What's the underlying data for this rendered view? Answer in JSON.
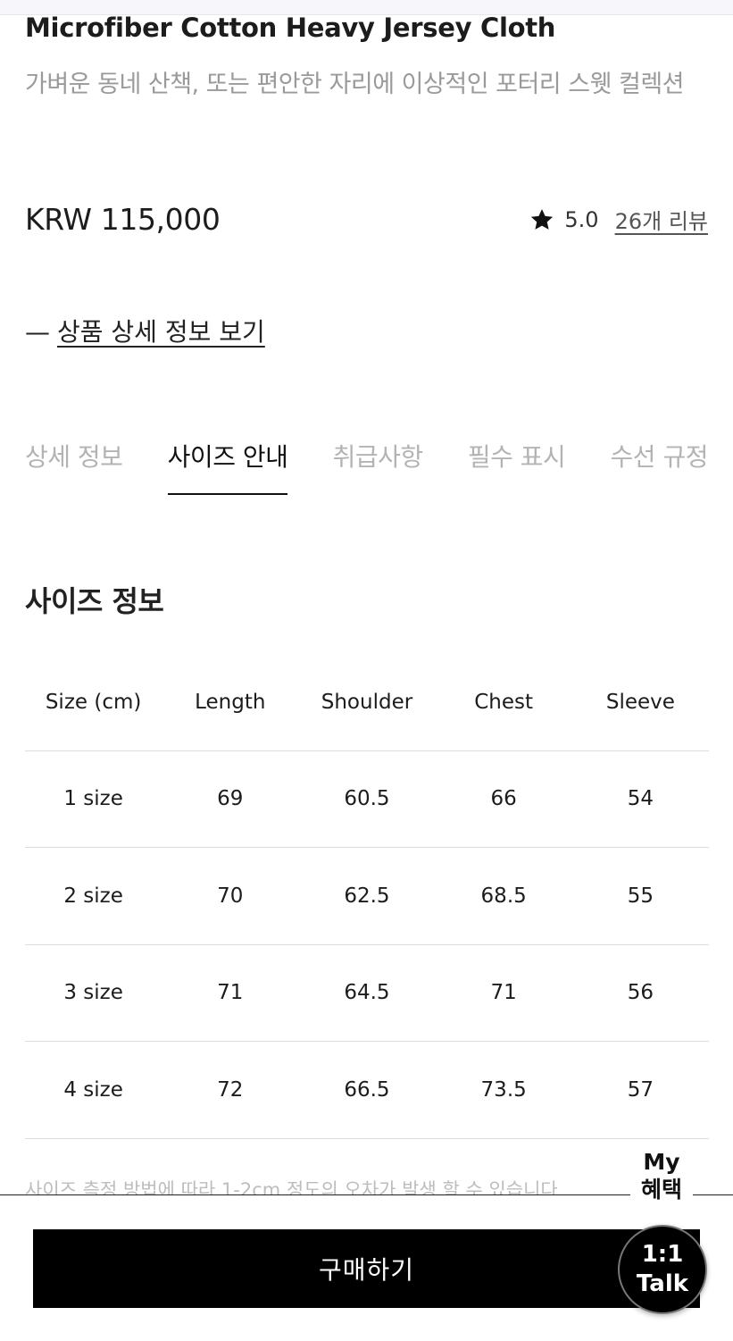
{
  "product": {
    "name": "Microfiber Cotton Heavy Jersey Cloth",
    "description": "가벼운 동네 산책, 또는 편안한 자리에 이상적인 포터리 스웻 컬렉션",
    "price": "KRW 115,000",
    "rating": "5.0",
    "review_count": "26개 리뷰",
    "detail_toggle_dash": "—",
    "detail_toggle_label": "상품 상세 정보 보기"
  },
  "tabs": [
    {
      "label": "상세 정보",
      "active": false
    },
    {
      "label": "사이즈 안내",
      "active": true
    },
    {
      "label": "취급사항",
      "active": false
    },
    {
      "label": "필수 표시",
      "active": false
    },
    {
      "label": "수선 규정",
      "active": false
    }
  ],
  "size_section": {
    "title": "사이즈 정보",
    "headers": [
      "Size (cm)",
      "Length",
      "Shoulder",
      "Chest",
      "Sleeve"
    ],
    "rows": [
      [
        "1 size",
        "69",
        "60.5",
        "66",
        "54"
      ],
      [
        "2 size",
        "70",
        "62.5",
        "68.5",
        "55"
      ],
      [
        "3 size",
        "71",
        "64.5",
        "71",
        "56"
      ],
      [
        "4 size",
        "72",
        "66.5",
        "73.5",
        "57"
      ]
    ],
    "note": "사이즈 측정 방법에 따라 1-2cm 정도의 오차가 발생 할 수 있습니다"
  },
  "bottom": {
    "buy_label": "구매하기",
    "my_benefit_line1": "My",
    "my_benefit_line2": "혜택",
    "talk_line1": "1:1",
    "talk_line2": "Talk"
  },
  "icons": {
    "rating": "star-icon"
  },
  "colors": {
    "active_tab": "#111111",
    "inactive_tab": "#b3b3b3",
    "buy_button_bg": "#000000",
    "muted_text": "#9a9a9a"
  }
}
